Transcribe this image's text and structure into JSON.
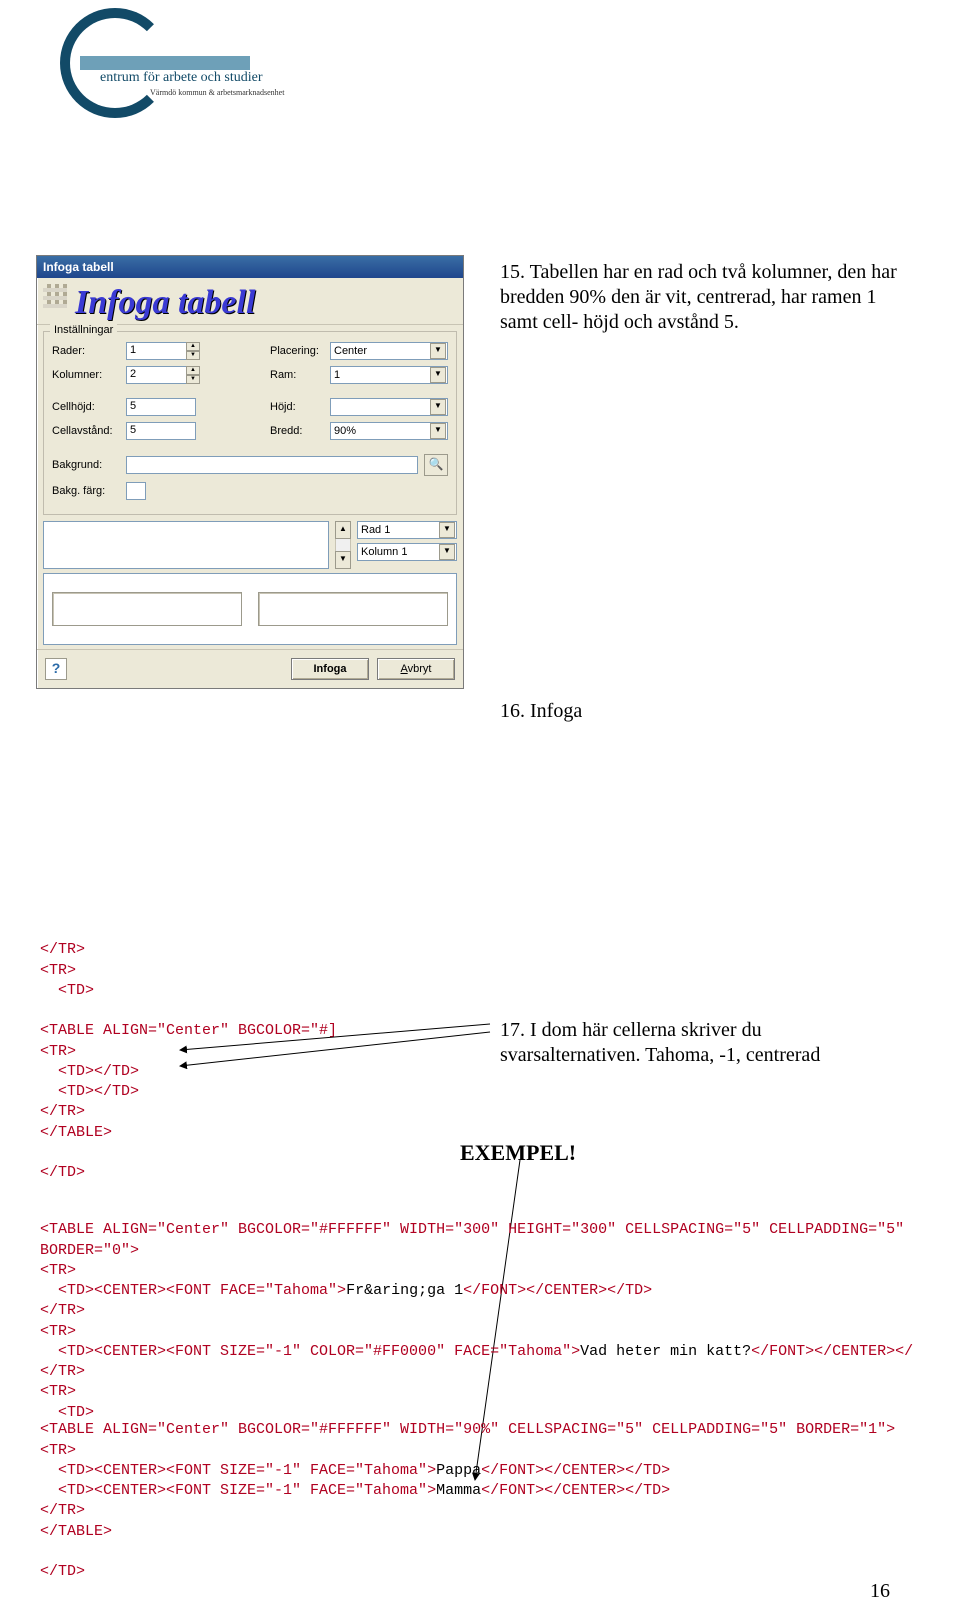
{
  "logo": {
    "text": "entrum för arbete och studier",
    "sub": "Värmdö kommun & arbetsmarknadsenhet"
  },
  "body15": "15. Tabellen har en rad och två kolumner, den har bredden 90% den är vit, centrerad, har ramen 1 samt cell- höjd och avstånd 5.",
  "item16": "16. Infoga",
  "item17": "17. I dom här cellerna skriver du svarsalternativen. Tahoma, -1, centrerad",
  "exempel": "EXEMPEL!",
  "pagenum": "16",
  "dialog": {
    "title": "Infoga tabell",
    "big_title": "Infoga tabell",
    "group_label": "Inställningar",
    "rows_label": "Rader:",
    "rows_value": "1",
    "cols_label": "Kolumner:",
    "cols_value": "2",
    "placement_label": "Placering:",
    "placement_value": "Center",
    "frame_label": "Ram:",
    "frame_value": "1",
    "cellheight_label": "Cellhöjd:",
    "cellheight_value": "5",
    "height_label": "Höjd:",
    "cellspace_label": "Cellavstånd:",
    "cellspace_value": "5",
    "width_label": "Bredd:",
    "width_value": "90%",
    "bg_label": "Bakgrund:",
    "bgcolor_label": "Bakg. färg:",
    "row_select": "Rad 1",
    "col_select": "Kolumn 1",
    "help": "?",
    "ok": "Infoga",
    "cancel": "Avbryt"
  },
  "code1": {
    "l1a": "</TR>",
    "l2a": "<TR>",
    "l3a": "  <TD>",
    "l4": "",
    "l5a": "<TABLE ALIGN=\"Center\" BGCOLOR=\"#]",
    "l6a": "<TR>",
    "l7a": "  <TD></TD>",
    "l8a": "  <TD></TD>",
    "l9a": "</TR>",
    "l10a": "</TABLE>",
    "l11": "",
    "l12a": "</TD>"
  },
  "code2": {
    "l1": "<TABLE ALIGN=\"Center\" BGCOLOR=\"#FFFFFF\" WIDTH=\"300\" HEIGHT=\"300\" CELLSPACING=\"5\" CELLPADDING=\"5\"",
    "l1b": "BORDER=\"0\">",
    "l2": "<TR>",
    "l3a": "  <TD><CENTER><FONT FACE=\"Tahoma\">",
    "l3t": "Fr&aring;ga 1",
    "l3b": "</FONT></CENTER></TD>",
    "l4": "</TR>",
    "l5": "<TR>",
    "l6a": "  <TD><CENTER><FONT SIZE=\"-1\" COLOR=\"#FF0000\" FACE=\"Tahoma\">",
    "l6t": "Vad heter min katt?",
    "l6b": "</FONT></CENTER></",
    "l7": "</TR>",
    "l8": "<TR>",
    "l9": "  <TD>"
  },
  "code3": {
    "l1": "<TABLE ALIGN=\"Center\" BGCOLOR=\"#FFFFFF\" WIDTH=\"90%\" CELLSPACING=\"5\" CELLPADDING=\"5\" BORDER=\"1\">",
    "l2": "<TR>",
    "l3a": "  <TD><CENTER><FONT SIZE=\"-1\" FACE=\"Tahoma\">",
    "l3t": "Pappa",
    "l3b": "</FONT></CENTER></TD>",
    "l4a": "  <TD><CENTER><FONT SIZE=\"-1\" FACE=\"Tahoma\">",
    "l4t": "Mamma",
    "l4b": "</FONT></CENTER></TD>",
    "l5": "</TR>",
    "l6": "</TABLE>",
    "l7": "",
    "l8": "</TD>"
  }
}
